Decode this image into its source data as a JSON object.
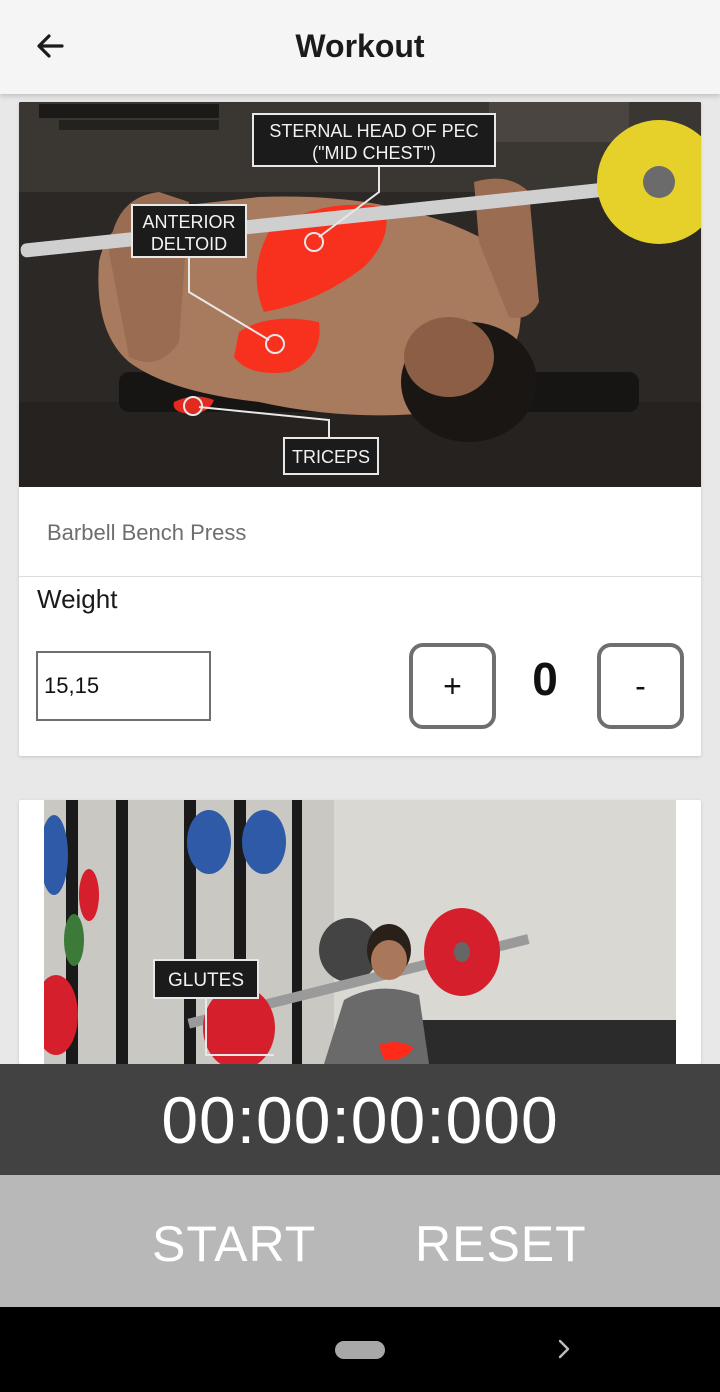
{
  "appbar": {
    "title": "Workout",
    "back_icon": "arrow-left-icon"
  },
  "exercises": [
    {
      "name": "Barbell Bench Press",
      "image_labels": {
        "sternal_line1": "STERNAL HEAD OF PEC",
        "sternal_line2": "(\"MID CHEST\")",
        "deltoid_line1": "ANTERIOR",
        "deltoid_line2": "DELTOID",
        "triceps": "TRICEPS"
      },
      "weight_label": "Weight",
      "weight_value": "15,15",
      "plus_label": "+",
      "counter": "0",
      "minus_label": "-"
    },
    {
      "image_labels": {
        "glutes": "GLUTES"
      }
    }
  ],
  "timer": {
    "display": "00:00:00:000",
    "start_label": "START",
    "reset_label": "RESET"
  },
  "colors": {
    "appbar_bg": "#f5f5f5",
    "timer_bg": "#424242",
    "controls_bg": "#b8b8b8",
    "muscle_highlight": "#ff2a1a",
    "plate_yellow": "#e6d12a",
    "plate_red": "#d61f2c"
  }
}
